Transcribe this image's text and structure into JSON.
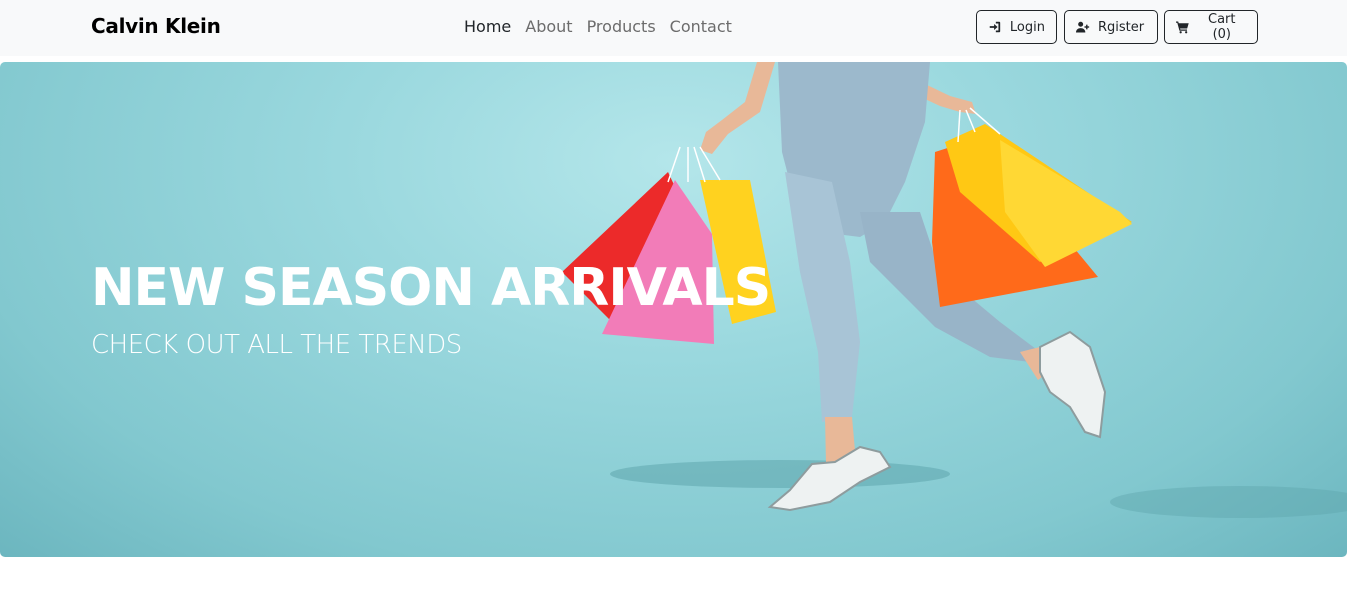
{
  "navbar": {
    "brand": "Calvin Klein",
    "links": [
      {
        "label": "Home",
        "active": true
      },
      {
        "label": "About",
        "active": false
      },
      {
        "label": "Products",
        "active": false
      },
      {
        "label": "Contact",
        "active": false
      }
    ],
    "buttons": {
      "login": {
        "label": "Login",
        "icon": "sign-in-icon"
      },
      "register": {
        "label": "Rgister",
        "icon": "user-plus-icon"
      },
      "cart": {
        "label": "Cart (0)",
        "icon": "shopping-cart-icon"
      }
    }
  },
  "hero": {
    "title": "NEW SEASON ARRIVALS",
    "subtitle": "CHECK OUT ALL THE TRENDS",
    "image": "woman-with-shopping-bags",
    "background_color": "#9ad8de"
  }
}
